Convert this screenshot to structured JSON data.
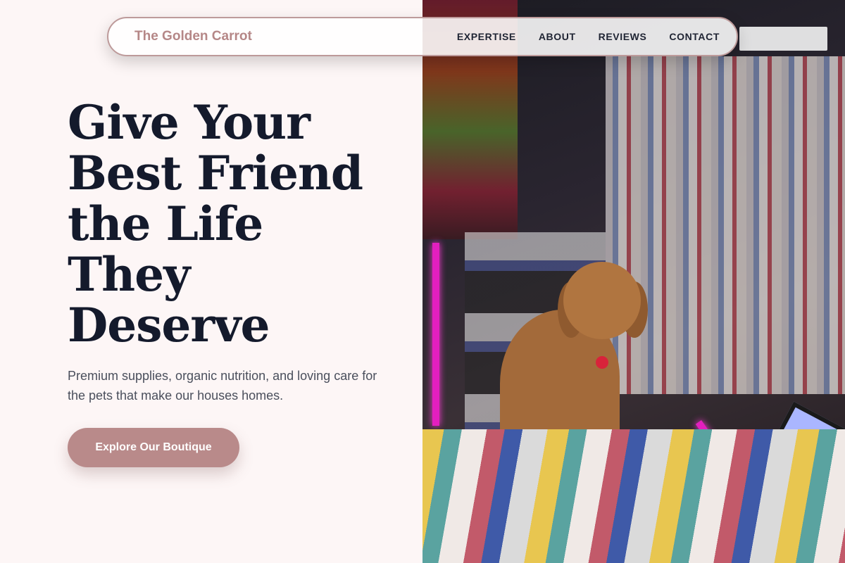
{
  "nav": {
    "brand": "The Golden Carrot",
    "links": [
      "EXPERTISE",
      "ABOUT",
      "REVIEWS",
      "CONTACT"
    ]
  },
  "hero": {
    "headline": "Give Your Best Friend the Life They Deserve",
    "subtext": "Premium supplies, organic nutrition, and loving care for the pets that make our houses homes.",
    "cta_label": "Explore Our Boutique"
  },
  "colors": {
    "background": "#fdf6f6",
    "accent": "#b98a8a",
    "headline": "#141a2c",
    "nav_border": "#bd9a9a"
  },
  "icons": {
    "hero_image": "dog-in-shop-photo"
  }
}
